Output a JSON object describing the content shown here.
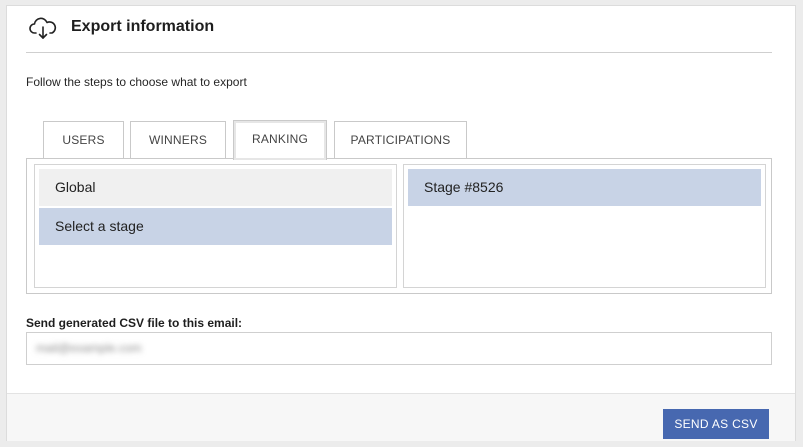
{
  "header": {
    "icon": "cloud-download-icon",
    "title": "Export information"
  },
  "instructions": "Follow the steps to choose what to export",
  "tabs": [
    {
      "label": "USERS",
      "active": false
    },
    {
      "label": "WINNERS",
      "active": false
    },
    {
      "label": "RANKING",
      "active": true
    },
    {
      "label": "PARTICIPATIONS",
      "active": false
    }
  ],
  "ranking": {
    "left_list": [
      {
        "label": "Global",
        "selected": false
      },
      {
        "label": "Select a stage",
        "selected": true
      }
    ],
    "right_list": [
      {
        "label": "Stage #8526",
        "selected": true
      }
    ]
  },
  "email": {
    "label": "Send generated CSV file to this email:",
    "value": "mail@example.com"
  },
  "footer": {
    "send_label": "SEND AS CSV"
  },
  "colors": {
    "accent": "#4768b0",
    "selected_item": "#c8d3e6",
    "plain_item": "#f0f0f0"
  }
}
